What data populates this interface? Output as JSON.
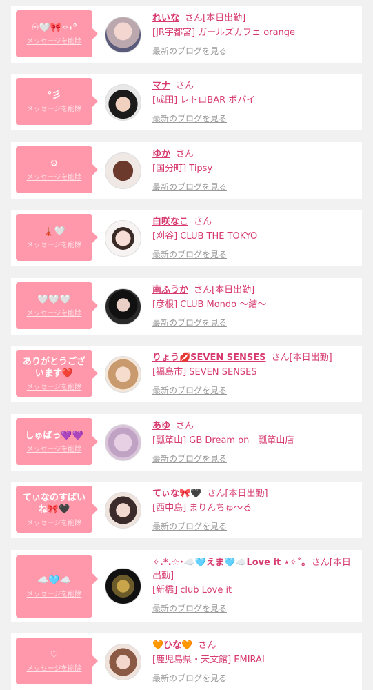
{
  "ui": {
    "delete_label": "メッセージを削除",
    "blog_label": "最新のブログを見る",
    "san": "さん",
    "today": "[本日出勤]"
  },
  "messages": [
    {
      "message": "♾🤍🎀✧˖°",
      "name": "れいな",
      "today": "[本日出勤]",
      "shop": "[JR宇都宮] ガールズカフェ orange"
    },
    {
      "message": "°彡",
      "name": "マナ",
      "today": "",
      "shop": "[成田] レトロBAR ポパイ"
    },
    {
      "message": "⚙",
      "name": "ゆか",
      "today": "",
      "shop": "[国分町] Tipsy"
    },
    {
      "message": "🗼🤍",
      "name": "白咲なこ",
      "today": "",
      "shop": "[刈谷] CLUB THE TOKYO"
    },
    {
      "message": "🤍🤍🤍",
      "name": "南ふうか",
      "today": "[本日出勤]",
      "shop": "[彦根] CLUB Mondo ～結～"
    },
    {
      "message": "ありがとうございます❤️",
      "name": "りょう💋SEVEN SENSES",
      "today": "[本日出勤]",
      "shop": "[福島市] SEVEN SENSES"
    },
    {
      "message": "しゅばっ💜💜",
      "name": "あゆ",
      "today": "",
      "shop": "[瓢箪山] GB Dream on　瓢箪山店"
    },
    {
      "message": "てぃなのすばいね🎀🖤",
      "name": "てぃな🎀🖤",
      "today": "[本日出勤]",
      "shop": "[西中島] まりんちゅ～る"
    },
    {
      "message": "☁️🩵☁️",
      "name": "✧.*.☆･☁️🩵えま🩵☁️Love it ⋆✧˚｡",
      "today": "[本日出勤]",
      "shop": "[新橋] club Love it"
    },
    {
      "message": "♡",
      "name": "🧡ひな🧡",
      "today": "",
      "shop": "[鹿児島県・天文館] EMIRAI"
    }
  ],
  "colors": {
    "bubble": "#ff98aa",
    "name": "#d63a6e",
    "background": "#f1f1f1",
    "link": "#999999"
  }
}
